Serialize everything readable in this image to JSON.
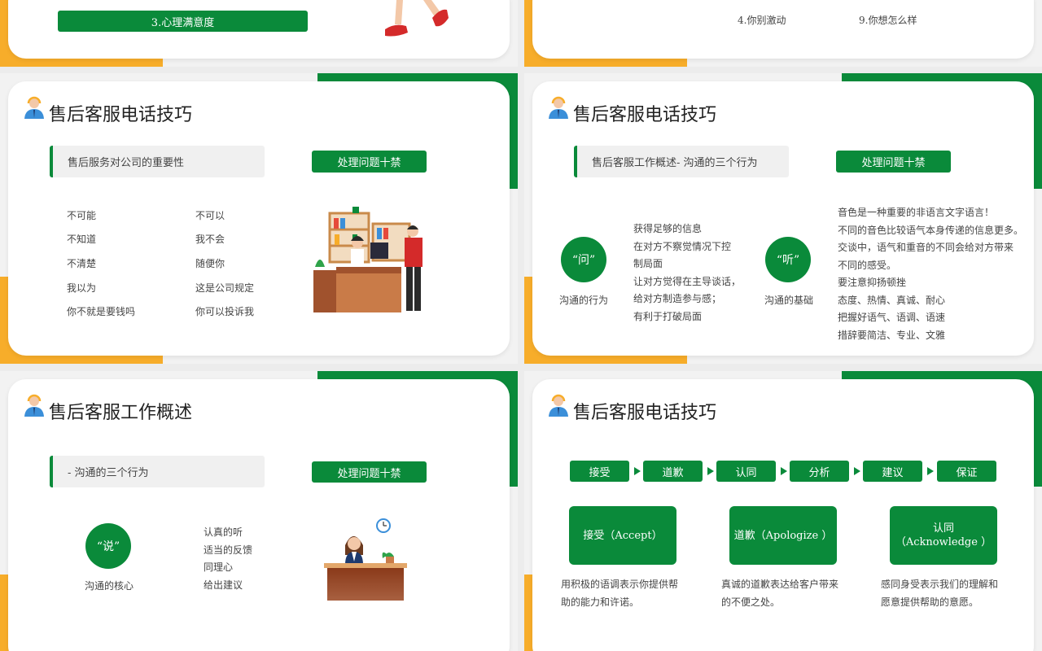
{
  "slide_top_left": {
    "button": "3.心理满意度"
  },
  "slide_top_right": {
    "col1": "4.你别激动",
    "col2": "9.你想怎么样"
  },
  "slide_mid_left": {
    "title": "售后客服电话技巧",
    "greybox": "售后服务对公司的重要性",
    "button": "处理问题十禁",
    "col1": [
      "不可能",
      "不知道",
      "不清楚",
      "我以为",
      "你不就是要钱吗"
    ],
    "col2": [
      "不可以",
      "我不会",
      "随便你",
      "这是公司规定",
      "你可以投诉我"
    ]
  },
  "slide_mid_right": {
    "title": "售后客服电话技巧",
    "greybox": "售后客服工作概述- 沟通的三个行为",
    "button": "处理问题十禁",
    "circle1": "“问”",
    "circle1_caption": "沟通的行为",
    "circle1_text": [
      "获得足够的信息",
      "在对方不察觉情况下控",
      "制局面",
      "让对方觉得在主导谈话，",
      "给对方制造参与感；",
      "有利于打破局面"
    ],
    "circle2": "“听”",
    "circle2_caption": "沟通的基础",
    "circle2_text": [
      "音色是一种重要的非语言文字语言！",
      "不同的音色比较语气本身传递的信息更多。",
      "交谈中，语气和重音的不同会给对方带来",
      "不同的感受。",
      "要注意抑扬顿挫",
      "态度、热情、真诚、耐心",
      "把握好语气、语调、语速",
      "措辞要简洁、专业、文雅"
    ]
  },
  "slide_bot_left": {
    "title": "售后客服工作概述",
    "greybox": "- 沟通的三个行为",
    "button": "处理问题十禁",
    "circle": "“说”",
    "circle_caption": "沟通的核心",
    "items": [
      "认真的听",
      "适当的反馈",
      "同理心",
      "给出建议"
    ]
  },
  "slide_bot_right": {
    "title": "售后客服电话技巧",
    "steps": [
      "接受",
      "道歉",
      "认同",
      "分析",
      "建议",
      "保证"
    ],
    "boxes": [
      {
        "label": "接受（Accept）",
        "desc": [
          "用积极的语调表示你提供帮",
          "助的能力和许诺。"
        ]
      },
      {
        "label": "道歉（Apologize ）",
        "desc": [
          "真诚的道歉表达给客户带来",
          "的不便之处。"
        ]
      },
      {
        "label": "认同\n（Acknowledge ）",
        "desc": [
          "感同身受表示我们的理解和",
          "愿意提供帮助的意愿。"
        ]
      }
    ]
  },
  "colors": {
    "green": "#0a8a3a",
    "orange": "#f7ad2a"
  }
}
